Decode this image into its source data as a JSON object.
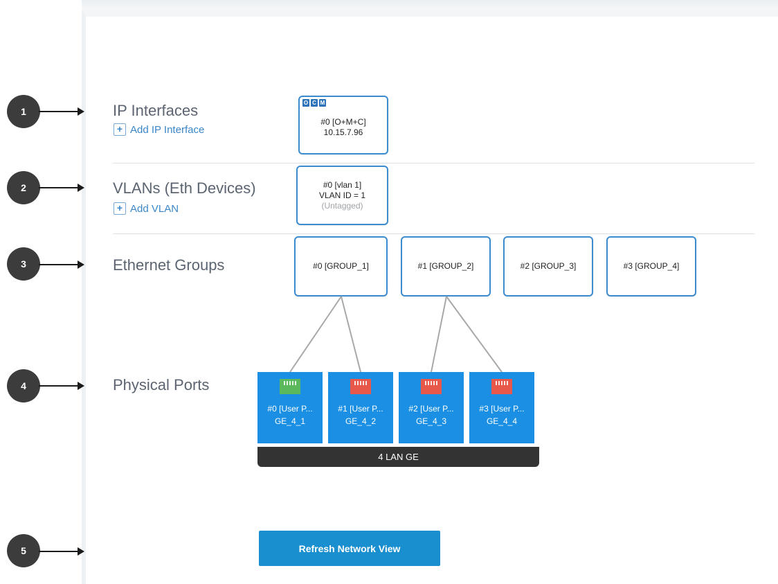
{
  "callouts": [
    "1",
    "2",
    "3",
    "4",
    "5"
  ],
  "ip_interfaces": {
    "title": "IP Interfaces",
    "add_label": "Add IP Interface",
    "cards": [
      {
        "badges": [
          "O",
          "C",
          "M"
        ],
        "line1": "#0 [O+M+C]",
        "line2": "10.15.7.96"
      }
    ]
  },
  "vlans": {
    "title": "VLANs (Eth Devices)",
    "add_label": "Add VLAN",
    "cards": [
      {
        "line1": "#0 [vlan 1]",
        "line2": "VLAN ID = 1",
        "line3": "(Untagged)"
      }
    ]
  },
  "ethernet_groups": {
    "title": "Ethernet Groups",
    "items": [
      "#0 [GROUP_1]",
      "#1 [GROUP_2]",
      "#2 [GROUP_3]",
      "#3 [GROUP_4]"
    ]
  },
  "physical_ports": {
    "title": "Physical Ports",
    "ports": [
      {
        "label": "#0 [User P...",
        "name": "GE_4_1",
        "icon": "ethernet-port-icon",
        "status_color": "#5cb85c"
      },
      {
        "label": "#1 [User P...",
        "name": "GE_4_2",
        "icon": "ethernet-port-icon",
        "status_color": "#e8584a"
      },
      {
        "label": "#2 [User P...",
        "name": "GE_4_3",
        "icon": "ethernet-port-icon",
        "status_color": "#e8584a"
      },
      {
        "label": "#3 [User P...",
        "name": "GE_4_4",
        "icon": "ethernet-port-icon",
        "status_color": "#e8584a"
      }
    ],
    "module_label": "4 LAN GE"
  },
  "refresh_label": "Refresh Network View",
  "colors": {
    "accent": "#1a8fe3",
    "card_border": "#3b8bd0",
    "link": "#3a86c8"
  }
}
